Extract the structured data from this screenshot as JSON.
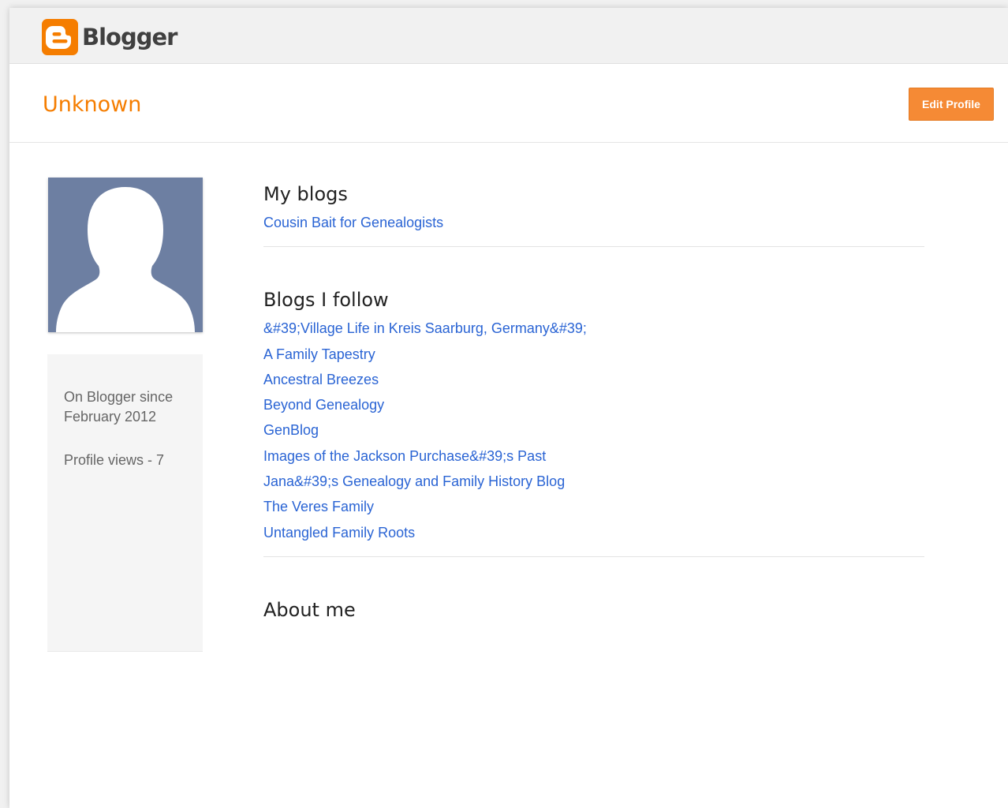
{
  "brand": {
    "name": "Blogger"
  },
  "profile": {
    "name": "Unknown",
    "edit_label": "Edit Profile",
    "since_line1": "On Blogger since",
    "since_line2": "February 2012",
    "views": "Profile views - 7"
  },
  "my_blogs": {
    "title": "My blogs",
    "items": [
      "Cousin Bait for Genealogists"
    ]
  },
  "blogs_follow": {
    "title": "Blogs I follow",
    "items": [
      "&#39;Village Life in Kreis Saarburg, Germany&#39;",
      "A Family Tapestry",
      "Ancestral Breezes",
      "Beyond Genealogy",
      "GenBlog",
      "Images of the Jackson Purchase&#39;s Past",
      "Jana&#39;s Genealogy and Family History Blog",
      "The Veres Family",
      "Untangled Family Roots"
    ]
  },
  "about": {
    "title": "About me"
  },
  "colors": {
    "accent": "#f57d00",
    "link": "#2a64d4",
    "avatar_bg": "#6d7fa2"
  },
  "icons": {
    "logo": "blogger-logo-icon",
    "avatar": "default-avatar-icon"
  }
}
